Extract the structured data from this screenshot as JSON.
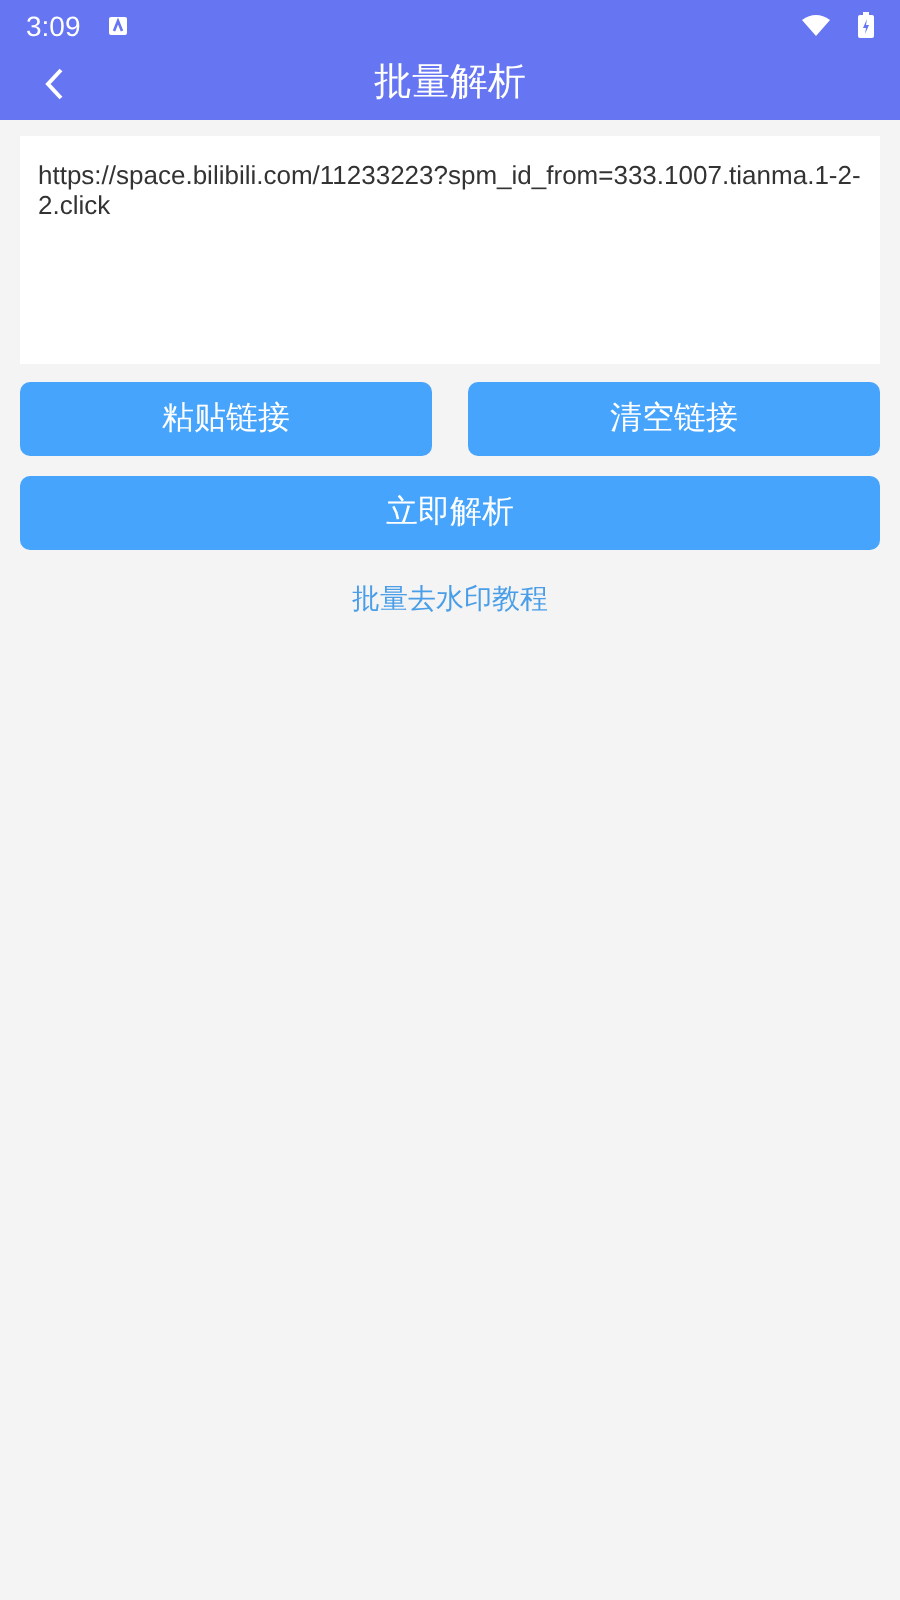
{
  "status_bar": {
    "time": "3:09"
  },
  "app_bar": {
    "title": "批量解析"
  },
  "link_field": {
    "value": "https://space.bilibili.com/11233223?spm_id_from=333.1007.tianma.1-2-2.click"
  },
  "buttons": [
    {
      "label": "粘贴链接"
    },
    {
      "label": "清空链接"
    },
    {
      "label": "立即解析"
    }
  ],
  "tutorial_link": "批量去水印教程"
}
